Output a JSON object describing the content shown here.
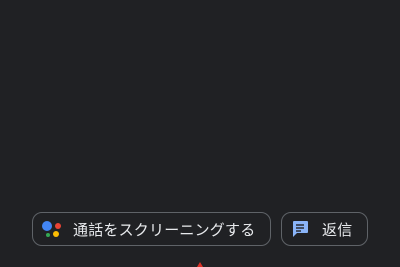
{
  "actions": {
    "screen_call": {
      "label": "通話をスクリーニングする",
      "icon": "google-assistant-icon"
    },
    "reply": {
      "label": "返信",
      "icon": "message-icon"
    }
  },
  "colors": {
    "background": "#202124",
    "chip_border": "#5f6368",
    "text": "#e8eaed",
    "accent": "#8ab4f8",
    "indicator": "#d93025"
  }
}
